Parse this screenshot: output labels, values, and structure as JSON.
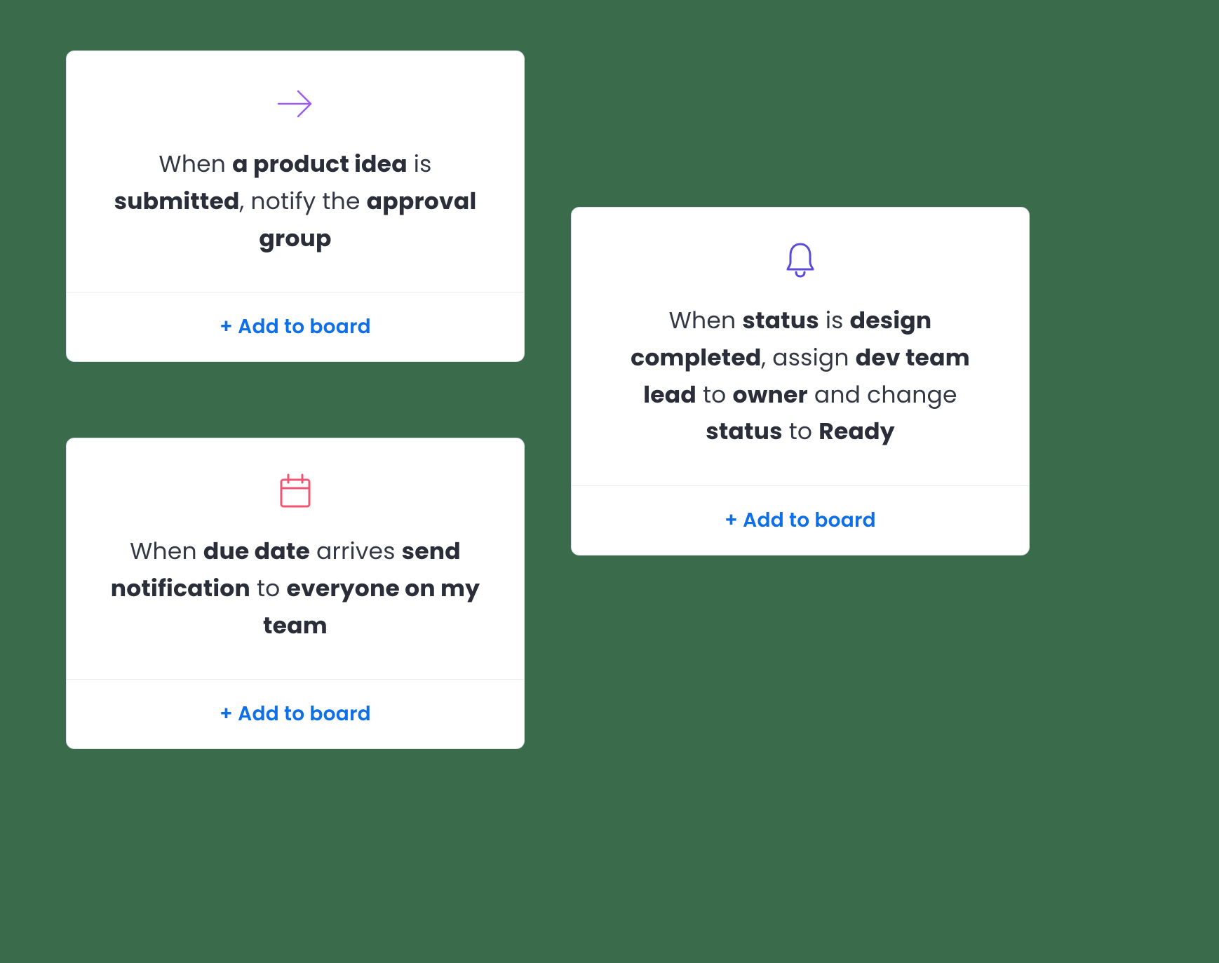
{
  "cards": [
    {
      "icon": "arrow-right",
      "iconColor": "#9b5cf0",
      "segments": [
        {
          "t": "When ",
          "b": false
        },
        {
          "t": "a product idea",
          "b": true
        },
        {
          "t": " is ",
          "b": false
        },
        {
          "t": "submitted",
          "b": true
        },
        {
          "t": ", notify the ",
          "b": false
        },
        {
          "t": "approval group",
          "b": true
        }
      ],
      "action": "+ Add to board"
    },
    {
      "icon": "calendar",
      "iconColor": "#f05673",
      "segments": [
        {
          "t": "When ",
          "b": false
        },
        {
          "t": "due date",
          "b": true
        },
        {
          "t": " arrives ",
          "b": false
        },
        {
          "t": "send notification",
          "b": true
        },
        {
          "t": " to ",
          "b": false
        },
        {
          "t": "everyone on my team",
          "b": true
        }
      ],
      "action": "+ Add to board"
    },
    {
      "icon": "bell",
      "iconColor": "#5a4bd9",
      "segments": [
        {
          "t": "When ",
          "b": false
        },
        {
          "t": "status",
          "b": true
        },
        {
          "t": " is ",
          "b": false
        },
        {
          "t": "design completed",
          "b": true
        },
        {
          "t": ", assign ",
          "b": false
        },
        {
          "t": "dev team lead",
          "b": true
        },
        {
          "t": " to ",
          "b": false
        },
        {
          "t": "owner",
          "b": true
        },
        {
          "t": " and change ",
          "b": false
        },
        {
          "t": "status",
          "b": true
        },
        {
          "t": " to ",
          "b": false
        },
        {
          "t": "Ready",
          "b": true
        }
      ],
      "action": "+ Add to board"
    }
  ]
}
